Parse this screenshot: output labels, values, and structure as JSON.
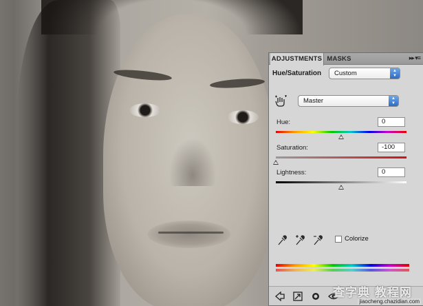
{
  "panel": {
    "tabs": [
      {
        "label": "ADJUSTMENTS",
        "active": true
      },
      {
        "label": "MASKS",
        "active": false
      }
    ],
    "menu_glyph": "▸▸ ▾≡",
    "adjustment_name": "Hue/Saturation",
    "preset": {
      "selected": "Custom"
    },
    "channel": {
      "selected": "Master"
    },
    "hue": {
      "label": "Hue:",
      "value": "0",
      "slider_fraction": 0.5
    },
    "saturation": {
      "label": "Saturation:",
      "value": "-100",
      "slider_fraction": 0.0
    },
    "lightness": {
      "label": "Lightness:",
      "value": "0",
      "slider_fraction": 0.5
    },
    "colorize": {
      "label": "Colorize",
      "checked": false
    }
  },
  "icons": {
    "targeted_adjustment": "hand-drag-icon",
    "droppers": [
      "eyedropper-icon",
      "eyedropper-plus-icon",
      "eyedropper-minus-icon"
    ],
    "footer": [
      "back-arrow-icon",
      "expand-view-icon",
      "clip-to-layer-icon",
      "visibility-eye-icon"
    ]
  },
  "watermark": {
    "cn_text": "查字典 教程网",
    "url": "jiaocheng.chazidian.com"
  }
}
